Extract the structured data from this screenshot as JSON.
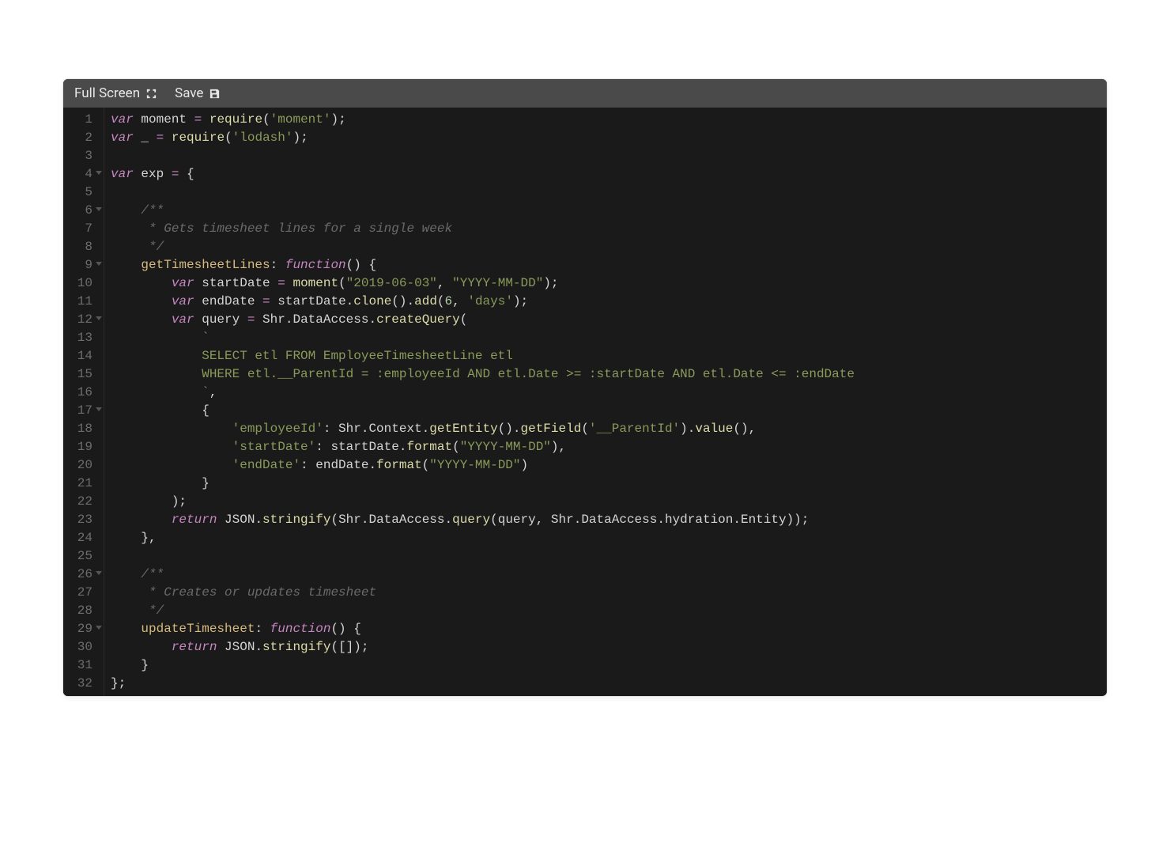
{
  "toolbar": {
    "full_screen_label": "Full Screen",
    "save_label": "Save"
  },
  "editor": {
    "lines": [
      {
        "num": 1,
        "fold": false,
        "tokens": [
          {
            "t": "kw",
            "v": "var"
          },
          {
            "t": "plain",
            "v": " moment "
          },
          {
            "t": "op",
            "v": "="
          },
          {
            "t": "plain",
            "v": " "
          },
          {
            "t": "fn",
            "v": "require"
          },
          {
            "t": "punct",
            "v": "("
          },
          {
            "t": "str",
            "v": "'moment'"
          },
          {
            "t": "punct",
            "v": ");"
          }
        ]
      },
      {
        "num": 2,
        "fold": false,
        "tokens": [
          {
            "t": "kw",
            "v": "var"
          },
          {
            "t": "plain",
            "v": " _ "
          },
          {
            "t": "op",
            "v": "="
          },
          {
            "t": "plain",
            "v": " "
          },
          {
            "t": "fn",
            "v": "require"
          },
          {
            "t": "punct",
            "v": "("
          },
          {
            "t": "str",
            "v": "'lodash'"
          },
          {
            "t": "punct",
            "v": ");"
          }
        ]
      },
      {
        "num": 3,
        "fold": false,
        "tokens": []
      },
      {
        "num": 4,
        "fold": true,
        "tokens": [
          {
            "t": "kw",
            "v": "var"
          },
          {
            "t": "plain",
            "v": " exp "
          },
          {
            "t": "op",
            "v": "="
          },
          {
            "t": "plain",
            "v": " "
          },
          {
            "t": "punct",
            "v": "{"
          }
        ]
      },
      {
        "num": 5,
        "fold": false,
        "tokens": []
      },
      {
        "num": 6,
        "fold": true,
        "tokens": [
          {
            "t": "plain",
            "v": "    "
          },
          {
            "t": "comment",
            "v": "/**"
          }
        ]
      },
      {
        "num": 7,
        "fold": false,
        "tokens": [
          {
            "t": "plain",
            "v": "    "
          },
          {
            "t": "comment",
            "v": " * Gets timesheet lines for a single week"
          }
        ]
      },
      {
        "num": 8,
        "fold": false,
        "tokens": [
          {
            "t": "plain",
            "v": "    "
          },
          {
            "t": "comment",
            "v": " */"
          }
        ]
      },
      {
        "num": 9,
        "fold": true,
        "tokens": [
          {
            "t": "plain",
            "v": "    "
          },
          {
            "t": "prop",
            "v": "getTimesheetLines"
          },
          {
            "t": "punct",
            "v": ": "
          },
          {
            "t": "kw",
            "v": "function"
          },
          {
            "t": "punct",
            "v": "() {"
          }
        ]
      },
      {
        "num": 10,
        "fold": false,
        "tokens": [
          {
            "t": "plain",
            "v": "        "
          },
          {
            "t": "kw",
            "v": "var"
          },
          {
            "t": "plain",
            "v": " startDate "
          },
          {
            "t": "op",
            "v": "="
          },
          {
            "t": "plain",
            "v": " "
          },
          {
            "t": "fn",
            "v": "moment"
          },
          {
            "t": "punct",
            "v": "("
          },
          {
            "t": "str",
            "v": "\"2019-06-03\""
          },
          {
            "t": "punct",
            "v": ", "
          },
          {
            "t": "str",
            "v": "\"YYYY-MM-DD\""
          },
          {
            "t": "punct",
            "v": ");"
          }
        ]
      },
      {
        "num": 11,
        "fold": false,
        "tokens": [
          {
            "t": "plain",
            "v": "        "
          },
          {
            "t": "kw",
            "v": "var"
          },
          {
            "t": "plain",
            "v": " endDate "
          },
          {
            "t": "op",
            "v": "="
          },
          {
            "t": "plain",
            "v": " startDate."
          },
          {
            "t": "fn",
            "v": "clone"
          },
          {
            "t": "punct",
            "v": "()."
          },
          {
            "t": "fn",
            "v": "add"
          },
          {
            "t": "punct",
            "v": "("
          },
          {
            "t": "num",
            "v": "6"
          },
          {
            "t": "punct",
            "v": ", "
          },
          {
            "t": "str",
            "v": "'days'"
          },
          {
            "t": "punct",
            "v": ");"
          }
        ]
      },
      {
        "num": 12,
        "fold": true,
        "tokens": [
          {
            "t": "plain",
            "v": "        "
          },
          {
            "t": "kw",
            "v": "var"
          },
          {
            "t": "plain",
            "v": " query "
          },
          {
            "t": "op",
            "v": "="
          },
          {
            "t": "plain",
            "v": " Shr.DataAccess."
          },
          {
            "t": "fn",
            "v": "createQuery"
          },
          {
            "t": "punct",
            "v": "("
          }
        ]
      },
      {
        "num": 13,
        "fold": false,
        "tokens": [
          {
            "t": "plain",
            "v": "            "
          },
          {
            "t": "str",
            "v": "`"
          }
        ]
      },
      {
        "num": 14,
        "fold": false,
        "tokens": [
          {
            "t": "str",
            "v": "            SELECT etl FROM EmployeeTimesheetLine etl"
          }
        ]
      },
      {
        "num": 15,
        "fold": false,
        "tokens": [
          {
            "t": "str",
            "v": "            WHERE etl.__ParentId = :employeeId AND etl.Date >= :startDate AND etl.Date <= :endDate"
          }
        ]
      },
      {
        "num": 16,
        "fold": false,
        "tokens": [
          {
            "t": "str",
            "v": "            `"
          },
          {
            "t": "punct",
            "v": ","
          }
        ]
      },
      {
        "num": 17,
        "fold": true,
        "tokens": [
          {
            "t": "plain",
            "v": "            "
          },
          {
            "t": "punct",
            "v": "{"
          }
        ]
      },
      {
        "num": 18,
        "fold": false,
        "tokens": [
          {
            "t": "plain",
            "v": "                "
          },
          {
            "t": "str",
            "v": "'employeeId'"
          },
          {
            "t": "punct",
            "v": ": Shr.Context."
          },
          {
            "t": "fn",
            "v": "getEntity"
          },
          {
            "t": "punct",
            "v": "()."
          },
          {
            "t": "fn",
            "v": "getField"
          },
          {
            "t": "punct",
            "v": "("
          },
          {
            "t": "str",
            "v": "'__ParentId'"
          },
          {
            "t": "punct",
            "v": ")."
          },
          {
            "t": "fn",
            "v": "value"
          },
          {
            "t": "punct",
            "v": "(),"
          }
        ]
      },
      {
        "num": 19,
        "fold": false,
        "tokens": [
          {
            "t": "plain",
            "v": "                "
          },
          {
            "t": "str",
            "v": "'startDate'"
          },
          {
            "t": "punct",
            "v": ": startDate."
          },
          {
            "t": "fn",
            "v": "format"
          },
          {
            "t": "punct",
            "v": "("
          },
          {
            "t": "str",
            "v": "\"YYYY-MM-DD\""
          },
          {
            "t": "punct",
            "v": "),"
          }
        ]
      },
      {
        "num": 20,
        "fold": false,
        "tokens": [
          {
            "t": "plain",
            "v": "                "
          },
          {
            "t": "str",
            "v": "'endDate'"
          },
          {
            "t": "punct",
            "v": ": endDate."
          },
          {
            "t": "fn",
            "v": "format"
          },
          {
            "t": "punct",
            "v": "("
          },
          {
            "t": "str",
            "v": "\"YYYY-MM-DD\""
          },
          {
            "t": "punct",
            "v": ")"
          }
        ]
      },
      {
        "num": 21,
        "fold": false,
        "tokens": [
          {
            "t": "plain",
            "v": "            "
          },
          {
            "t": "punct",
            "v": "}"
          }
        ]
      },
      {
        "num": 22,
        "fold": false,
        "tokens": [
          {
            "t": "plain",
            "v": "        "
          },
          {
            "t": "punct",
            "v": ");"
          }
        ]
      },
      {
        "num": 23,
        "fold": false,
        "tokens": [
          {
            "t": "plain",
            "v": "        "
          },
          {
            "t": "kw",
            "v": "return"
          },
          {
            "t": "plain",
            "v": " "
          },
          {
            "t": "type",
            "v": "JSON"
          },
          {
            "t": "punct",
            "v": "."
          },
          {
            "t": "fn",
            "v": "stringify"
          },
          {
            "t": "punct",
            "v": "(Shr.DataAccess."
          },
          {
            "t": "fn",
            "v": "query"
          },
          {
            "t": "punct",
            "v": "(query, Shr.DataAccess.hydration.Entity));"
          }
        ]
      },
      {
        "num": 24,
        "fold": false,
        "tokens": [
          {
            "t": "plain",
            "v": "    "
          },
          {
            "t": "punct",
            "v": "},"
          }
        ]
      },
      {
        "num": 25,
        "fold": false,
        "tokens": []
      },
      {
        "num": 26,
        "fold": true,
        "tokens": [
          {
            "t": "plain",
            "v": "    "
          },
          {
            "t": "comment",
            "v": "/**"
          }
        ]
      },
      {
        "num": 27,
        "fold": false,
        "tokens": [
          {
            "t": "plain",
            "v": "    "
          },
          {
            "t": "comment",
            "v": " * Creates or updates timesheet"
          }
        ]
      },
      {
        "num": 28,
        "fold": false,
        "tokens": [
          {
            "t": "plain",
            "v": "    "
          },
          {
            "t": "comment",
            "v": " */"
          }
        ]
      },
      {
        "num": 29,
        "fold": true,
        "tokens": [
          {
            "t": "plain",
            "v": "    "
          },
          {
            "t": "prop",
            "v": "updateTimesheet"
          },
          {
            "t": "punct",
            "v": ": "
          },
          {
            "t": "kw",
            "v": "function"
          },
          {
            "t": "punct",
            "v": "() {"
          }
        ]
      },
      {
        "num": 30,
        "fold": false,
        "tokens": [
          {
            "t": "plain",
            "v": "        "
          },
          {
            "t": "kw",
            "v": "return"
          },
          {
            "t": "plain",
            "v": " "
          },
          {
            "t": "type",
            "v": "JSON"
          },
          {
            "t": "punct",
            "v": "."
          },
          {
            "t": "fn",
            "v": "stringify"
          },
          {
            "t": "punct",
            "v": "([]);"
          }
        ]
      },
      {
        "num": 31,
        "fold": false,
        "tokens": [
          {
            "t": "plain",
            "v": "    "
          },
          {
            "t": "punct",
            "v": "}"
          }
        ]
      },
      {
        "num": 32,
        "fold": false,
        "tokens": [
          {
            "t": "punct",
            "v": "};"
          }
        ]
      }
    ]
  }
}
